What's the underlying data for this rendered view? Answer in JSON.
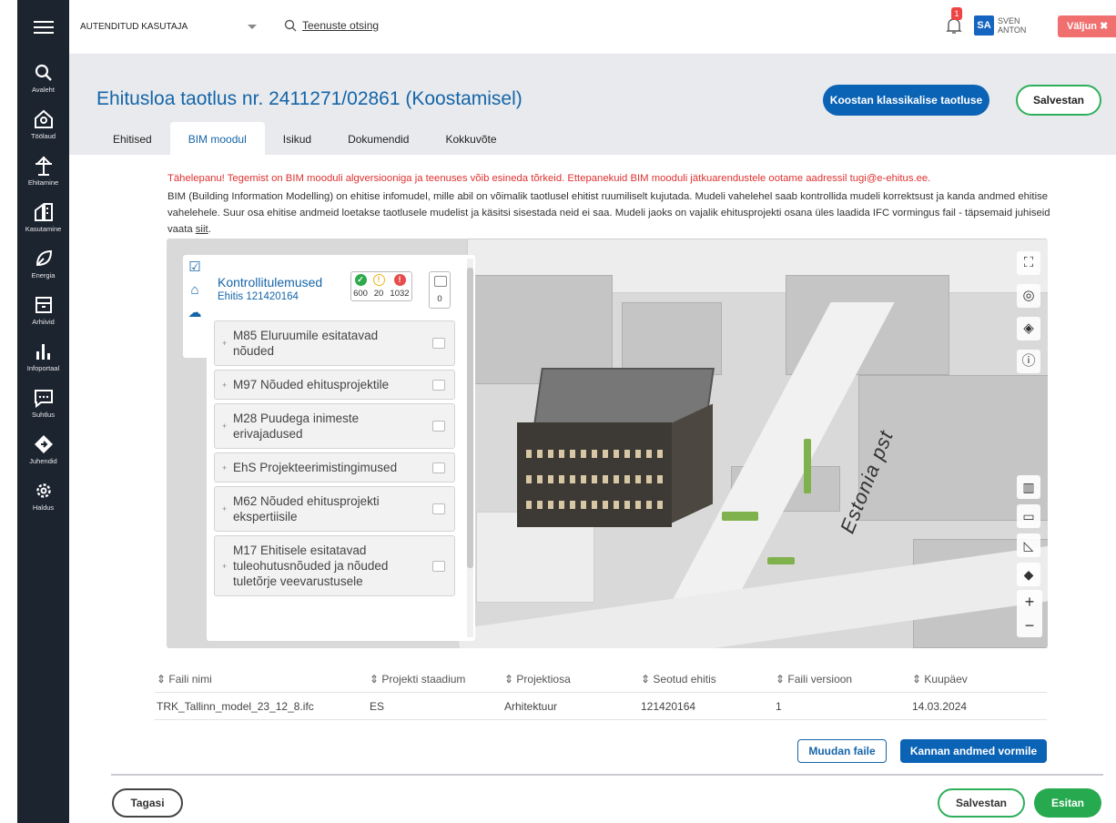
{
  "rail": {
    "items": [
      {
        "label": "Avaleht",
        "icon": "search-icon"
      },
      {
        "label": "Töölaud",
        "icon": "home-search-icon"
      },
      {
        "label": "Ehitamine",
        "icon": "crane-icon"
      },
      {
        "label": "Kasutamine",
        "icon": "building-icon"
      },
      {
        "label": "Energia",
        "icon": "leaf-icon"
      },
      {
        "label": "Arhiivid",
        "icon": "archive-icon"
      },
      {
        "label": "Infoportaal",
        "icon": "bar-chart-icon"
      },
      {
        "label": "Suhtlus",
        "icon": "chat-icon"
      },
      {
        "label": "Juhendid",
        "icon": "guide-icon"
      },
      {
        "label": "Haldus",
        "icon": "gear-icon"
      }
    ]
  },
  "topbar": {
    "role": "AUTENDITUD KASUTAJA",
    "search_label": "Teenuste otsing",
    "notification_count": "1",
    "user_initials": "SA",
    "user_first": "SVEN",
    "user_last": "ANTON",
    "logout_label": "Väljun"
  },
  "header": {
    "title": "Ehitusloa taotlus nr. 2411271/02861 (Koostamisel)",
    "classic_button": "Koostan klassikalise taotluse",
    "save_button": "Salvestan",
    "tabs": [
      "Ehitised",
      "BIM moodul",
      "Isikud",
      "Dokumendid",
      "Kokkuvõte"
    ],
    "active_tab": "BIM moodul"
  },
  "notice": {
    "warning": "Tähelepanu! Tegemist on BIM mooduli algversiooniga ja teenuses võib esineda tõrkeid. Ettepanekuid BIM mooduli jätkuarendustele ootame aadressil tugi@e-ehitus.ee.",
    "info": "BIM (Building Information Modelling) on ehitise infomudel, mille abil on võimalik taotlusel ehitist ruumiliselt kujutada. Mudeli vahelehel saab kontrollida mudeli korrektsust ja kanda andmed ehitise vahelehele. Suur osa ehitise andmeid loetakse taotlusele mudelist ja käsitsi sisestada neid ei saa. Mudeli jaoks on vajalik ehitusprojekti osana üles laadida IFC vormingus fail - täpsemaid juhiseid vaata",
    "link": "siit",
    "after": "."
  },
  "viewer": {
    "street_label": "Estonia pst",
    "panel_title": "Kontrollitulemused",
    "panel_subtitle": "Ehitis 121420164",
    "count_ok": "600",
    "count_warn": "20",
    "count_err": "1032",
    "count_comments": "0",
    "colors": {
      "ok": "#2eaa4a",
      "warn": "#f2b51c",
      "err": "#e84d4d"
    },
    "checks": [
      "M85 Eluruumile esitatavad nõuded",
      "M97 Nõuded ehitusprojektile",
      "M28 Puudega inimeste erivajadused",
      "EhS Projekteerimistingimused",
      "M62 Nõuded ehitusprojekti ekspertiisile",
      "M17 Ehitisele esitatavad tuleohutusnõuded ja nõuded tuletõrje veevarustusele"
    ]
  },
  "table": {
    "headers": [
      "Faili nimi",
      "Projekti staadium",
      "Projektiosa",
      "Seotud ehitis",
      "Faili versioon",
      "Kuupäev"
    ],
    "rows": [
      [
        "TRK_Tallinn_model_23_12_8.ifc",
        "ES",
        "Arhitektuur",
        "121420164",
        "1",
        "14.03.2024"
      ]
    ]
  },
  "actions": {
    "edit_files": "Muudan faile",
    "transfer_data": "Kannan andmed vormile",
    "back": "Tagasi",
    "save": "Salvestan",
    "submit": "Esitan"
  }
}
